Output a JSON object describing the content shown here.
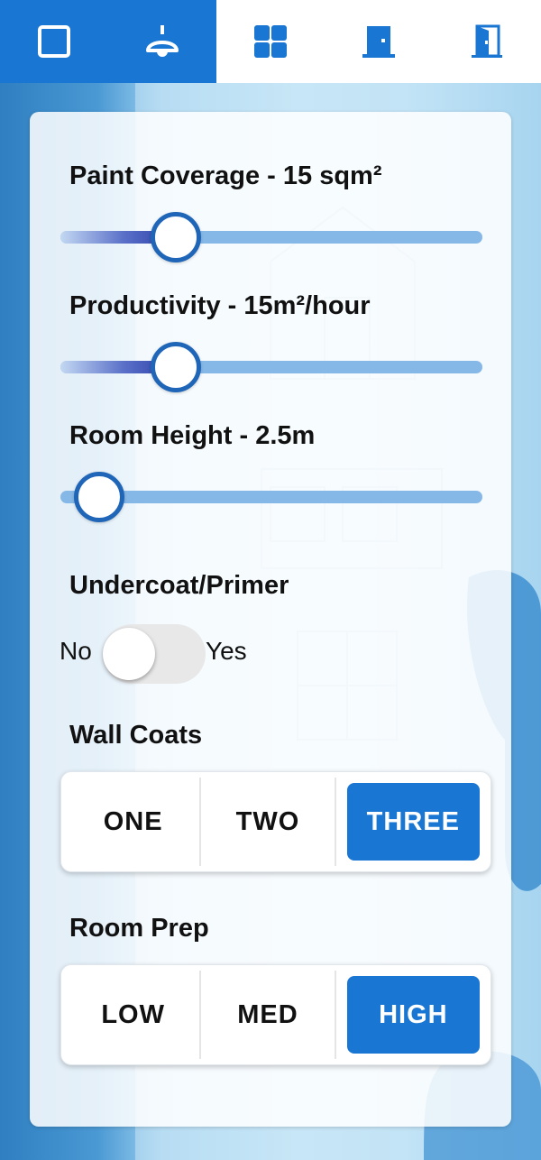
{
  "tabs": [
    {
      "icon": "square-outline-icon",
      "active": true
    },
    {
      "icon": "ceiling-lamp-icon",
      "active": true
    },
    {
      "icon": "window-icon",
      "active": false
    },
    {
      "icon": "door-icon",
      "active": false
    },
    {
      "icon": "door-frame-icon",
      "active": false
    }
  ],
  "settings": {
    "paint_coverage": {
      "label": "Paint Coverage - 15 sqm²",
      "value_fraction": 0.25
    },
    "productivity": {
      "label": "Productivity - 15m²/hour",
      "value_fraction": 0.25
    },
    "room_height": {
      "label": "Room Height - 2.5m",
      "value_fraction": 0.05
    },
    "undercoat": {
      "label": "Undercoat/Primer",
      "off_label": "No",
      "on_label": "Yes",
      "on": false
    },
    "wall_coats": {
      "label": "Wall Coats",
      "options": [
        "ONE",
        "TWO",
        "THREE"
      ],
      "selected": "THREE"
    },
    "room_prep": {
      "label": "Room Prep",
      "options": [
        "LOW",
        "MED",
        "HIGH"
      ],
      "selected": "HIGH"
    }
  },
  "colors": {
    "accent": "#1976d2",
    "slider_thumb_border": "#1f66b8",
    "slider_track": "#86b8e7"
  }
}
